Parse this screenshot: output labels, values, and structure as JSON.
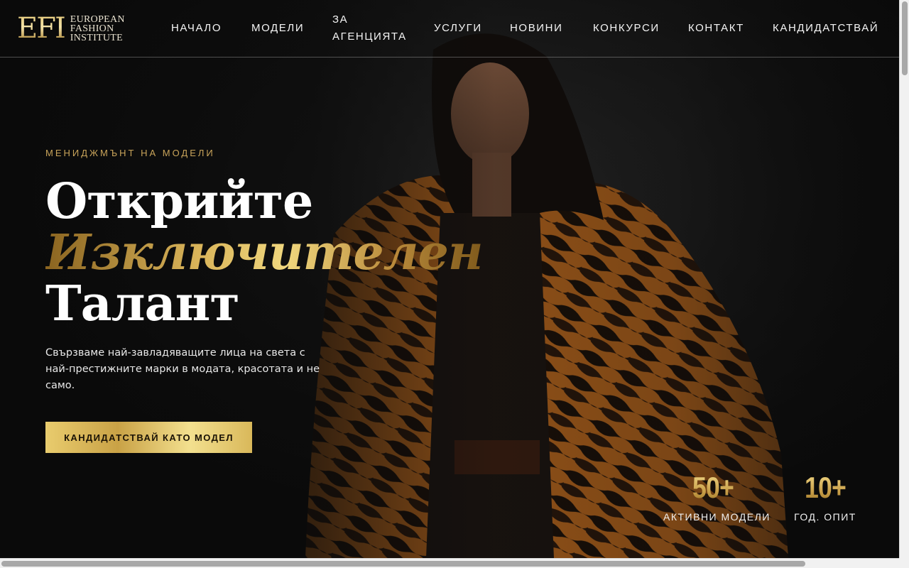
{
  "brand": {
    "logo_mark": "EFI",
    "logo_line1": "European",
    "logo_line2": "Fashion",
    "logo_line3": "Institute",
    "gold": "#c9a45a"
  },
  "nav": {
    "items": [
      {
        "label": "НАЧАЛО"
      },
      {
        "label": "МОДЕЛИ"
      },
      {
        "label": "ЗА"
      },
      {
        "label": "АГЕНЦИЯТА"
      },
      {
        "label": "УСЛУГИ"
      },
      {
        "label": "НОВИНИ"
      },
      {
        "label": "КОНКУРСИ"
      },
      {
        "label": "КОНТАКТ"
      },
      {
        "label": "КАНДИДАТСТВАЙ"
      }
    ]
  },
  "hero": {
    "eyebrow": "МЕНИДЖМЪНТ НА МОДЕЛИ",
    "headline_line1": "Открийте",
    "headline_line2": "Изключителен",
    "headline_line3": "Талант",
    "subtitle": "Свързваме най-завладяващите лица на света с най-престижните марки в модата, красотата и не само.",
    "cta_label": "КАНДИДАТСТВАЙ КАТО МОДЕЛ"
  },
  "stats": [
    {
      "value": "50+",
      "label": "АКТИВНИ МОДЕЛИ"
    },
    {
      "value": "10+",
      "label": "ГОД. ОПИТ"
    }
  ],
  "background_image": {
    "icon": "runway-model-photo"
  }
}
